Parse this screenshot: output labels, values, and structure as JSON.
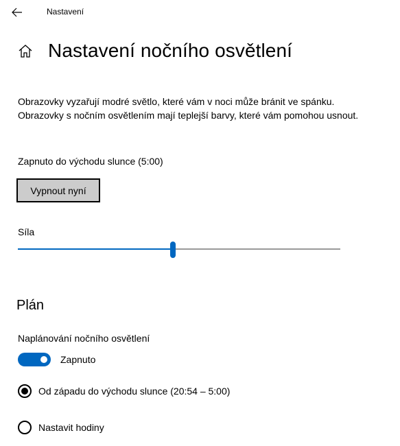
{
  "window": {
    "title": "Nastavení"
  },
  "header": {
    "title": "Nastavení nočního osvětlení"
  },
  "description": "Obrazovky vyzařují modré světlo, které vám v noci může bránit ve spánku. Obrazovky s nočním osvětlením mají teplejší barvy, které vám pomohou usnout.",
  "status": "Zapnuto do východu slunce (5:00)",
  "turn_off_button": "Vypnout nyní",
  "strength": {
    "label": "Síla",
    "value_percent": 48
  },
  "schedule": {
    "section_title": "Plán",
    "label": "Naplánování nočního osvětlení",
    "toggle_state": "on",
    "toggle_text": "Zapnuto",
    "options": [
      {
        "label": "Od západu do východu slunce (20:54 – 5:00)",
        "selected": true
      },
      {
        "label": "Nastavit hodiny",
        "selected": false
      }
    ]
  },
  "icons": {
    "back": "back-arrow-icon",
    "home": "home-icon"
  },
  "colors": {
    "accent": "#0067c0",
    "button_bg": "#cccccc"
  }
}
